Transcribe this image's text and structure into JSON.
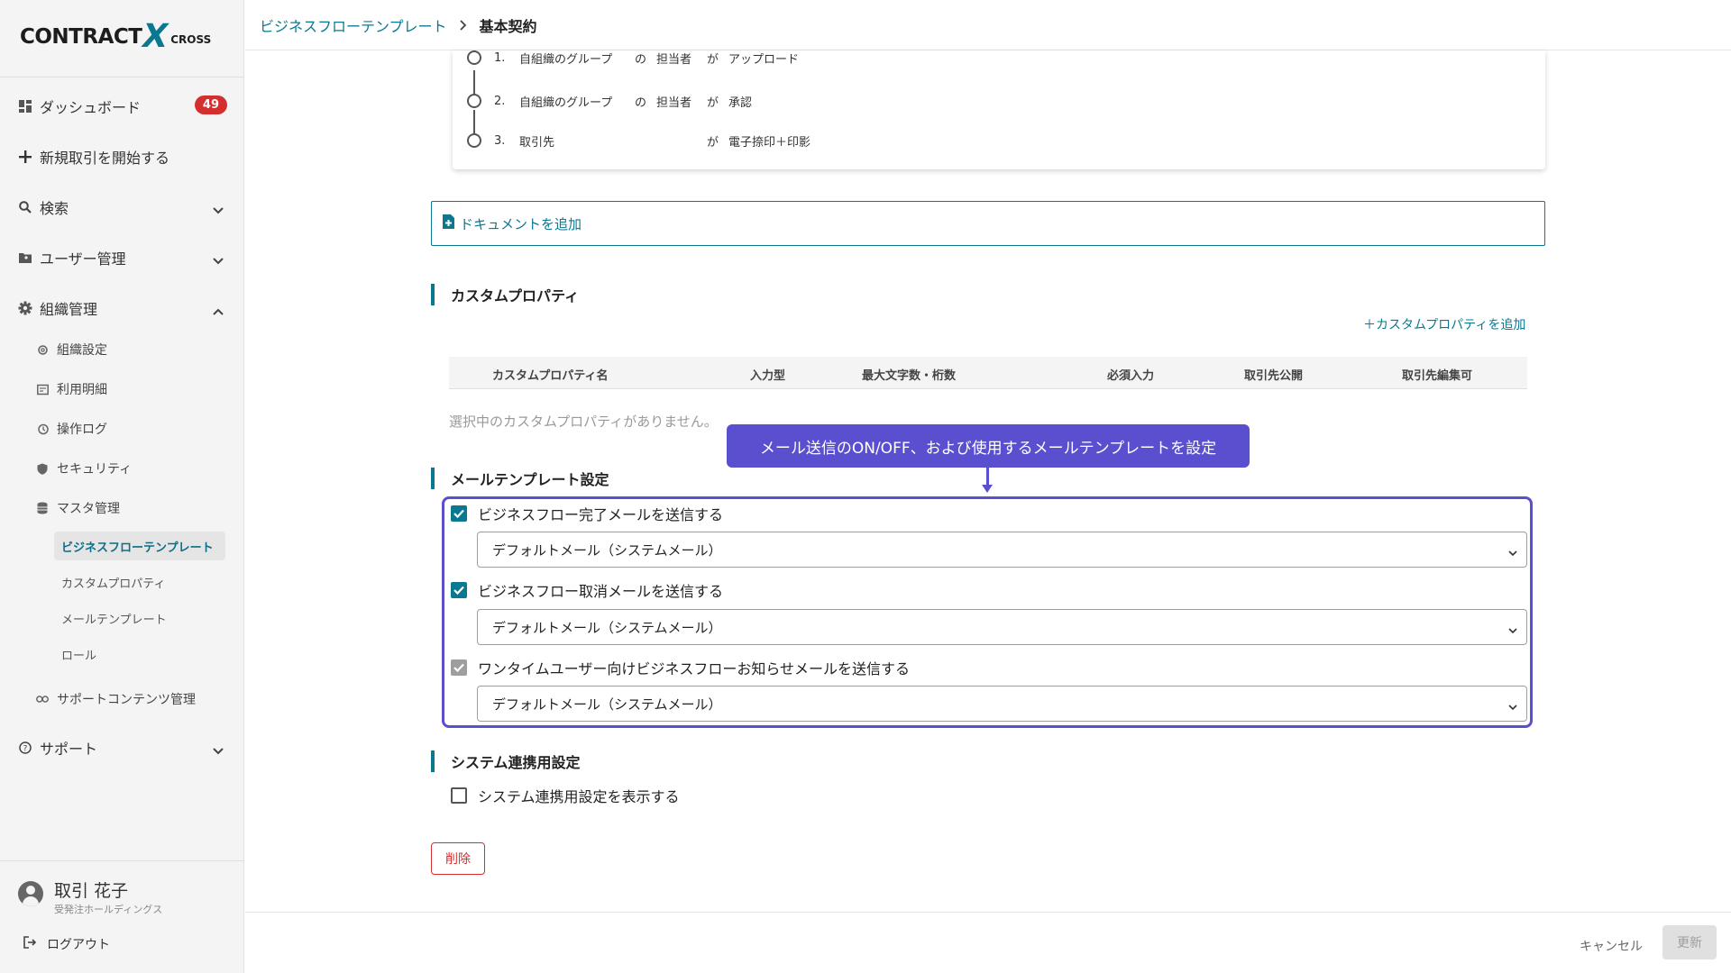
{
  "logo": {
    "part1": "CONTRACT",
    "x": "X",
    "part2": "CROSS"
  },
  "sidebar": {
    "dashboard": {
      "label": "ダッシュボード",
      "badge": "49"
    },
    "new_deal": {
      "label": "新規取引を開始する"
    },
    "search": {
      "label": "検索"
    },
    "user_mgmt": {
      "label": "ユーザー管理"
    },
    "org_mgmt": {
      "label": "組織管理"
    },
    "org_items": [
      {
        "label": "組織設定"
      },
      {
        "label": "利用明細"
      },
      {
        "label": "操作ログ"
      },
      {
        "label": "セキュリティ"
      },
      {
        "label": "マスタ管理"
      }
    ],
    "master_items": [
      {
        "label": "ビジネスフローテンプレート"
      },
      {
        "label": "カスタムプロパティ"
      },
      {
        "label": "メールテンプレート"
      },
      {
        "label": "ロール"
      }
    ],
    "support_content": {
      "label": "サポートコンテンツ管理"
    },
    "support": {
      "label": "サポート"
    },
    "user": {
      "name": "取引 花子",
      "org": "受発注ホールディングス"
    },
    "logout": "ログアウト"
  },
  "header": {
    "breadcrumb_link": "ビジネスフローテンプレート",
    "breadcrumb_current": "基本契約"
  },
  "flow_steps": [
    {
      "num": "1.",
      "group": "自組織のグループ",
      "p1": "の",
      "role": "担当者",
      "p2": "が",
      "action": "アップロード"
    },
    {
      "num": "2.",
      "group": "自組織のグループ",
      "p1": "の",
      "role": "担当者",
      "p2": "が",
      "action": "承認"
    },
    {
      "num": "3.",
      "group": "取引先",
      "p1": "",
      "role": "",
      "p2": "が",
      "action": "電子捺印＋印影"
    }
  ],
  "add_document": "ドキュメントを追加",
  "custom_property": {
    "title": "カスタムプロパティ",
    "add_label": "＋カスタムプロパティを追加",
    "columns": [
      "カスタムプロパティ名",
      "入力型",
      "最大文字数・桁数",
      "必須入力",
      "取引先公開",
      "取引先編集可"
    ],
    "empty": "選択中のカスタムプロパティがありません。"
  },
  "tooltip": "メール送信のON/OFF、および使用するメールテンプレートを設定",
  "mail_template": {
    "title": "メールテンプレート設定",
    "items": [
      {
        "label": "ビジネスフロー完了メールを送信する",
        "checked": true,
        "select": "デフォルトメール（システムメール）"
      },
      {
        "label": "ビジネスフロー取消メールを送信する",
        "checked": true,
        "select": "デフォルトメール（システムメール）"
      },
      {
        "label": "ワンタイムユーザー向けビジネスフローお知らせメールを送信する",
        "checked": true,
        "disabled": true,
        "select": "デフォルトメール（システムメール）"
      }
    ]
  },
  "system": {
    "title": "システム連携用設定",
    "checkbox_label": "システム連携用設定を表示する"
  },
  "delete_label": "削除",
  "footer": {
    "cancel": "キャンセル",
    "update": "更新"
  },
  "colors": {
    "accent": "#0a7891",
    "tooltip": "#5a4fcf",
    "danger": "#d32f2f"
  }
}
